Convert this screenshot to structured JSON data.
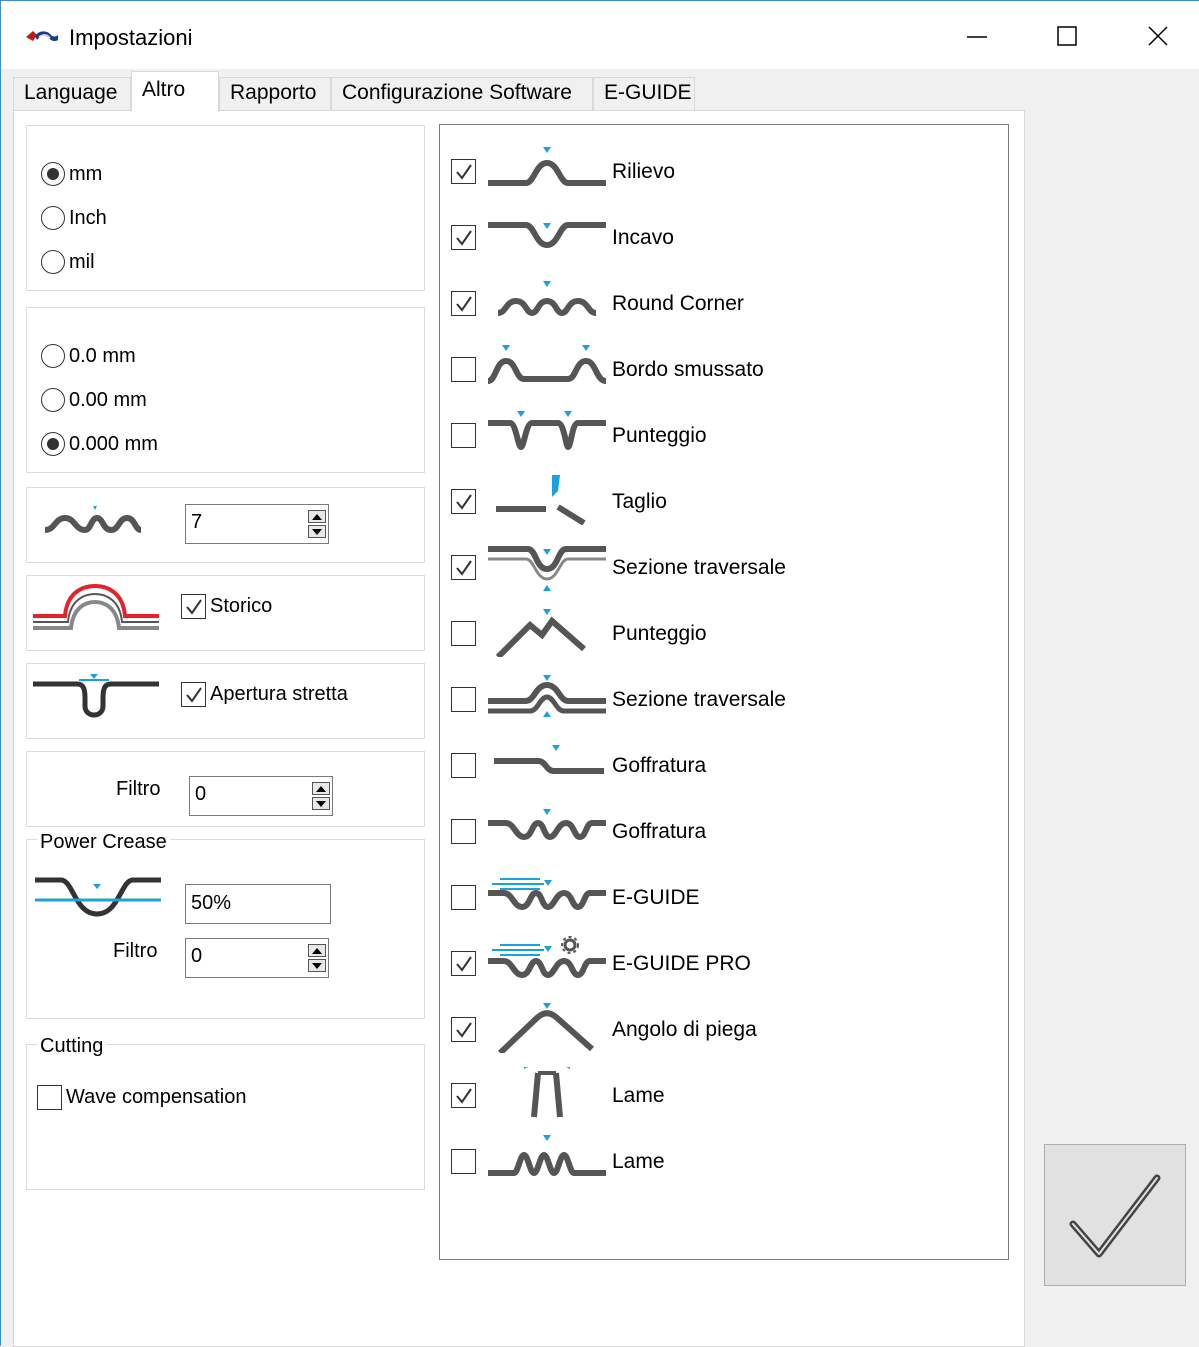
{
  "window": {
    "title": "Impostazioni",
    "controls": [
      "minimize-icon",
      "maximize-icon",
      "close-icon"
    ]
  },
  "tabs": [
    {
      "label": "Language",
      "active": false
    },
    {
      "label": "Altro",
      "active": true
    },
    {
      "label": "Rapporto",
      "active": false
    },
    {
      "label": "Configurazione Software",
      "active": false
    },
    {
      "label": "E-GUIDE",
      "active": false
    }
  ],
  "units": {
    "options": [
      "mm",
      "Inch",
      "mil"
    ],
    "selected": "mm"
  },
  "precision": {
    "options": [
      "0.0 mm",
      "0.00 mm",
      "0.000 mm"
    ],
    "selected": "0.000 mm"
  },
  "round_corner_setting": {
    "icon": "round-corner-wave-icon",
    "value": "7"
  },
  "storico": {
    "label": "Storico",
    "checked": true
  },
  "apertura_stretta": {
    "label": "Apertura stretta",
    "checked": true
  },
  "filter1": {
    "label": "Filtro",
    "value": "0"
  },
  "power_crease": {
    "title": "Power Crease",
    "percent": "50%",
    "filter_label": "Filtro",
    "filter_value": "0"
  },
  "cutting": {
    "title": "Cutting",
    "wave_compensation_label": "Wave compensation",
    "wave_compensation_checked": false
  },
  "tools": [
    {
      "label": "Rilievo",
      "checked": true,
      "icon": "bump-up-icon"
    },
    {
      "label": "Incavo",
      "checked": true,
      "icon": "bump-down-icon"
    },
    {
      "label": "Round Corner",
      "checked": true,
      "icon": "triple-wave-icon"
    },
    {
      "label": "Bordo smussato",
      "checked": false,
      "icon": "double-bump-icon"
    },
    {
      "label": "Punteggio",
      "checked": false,
      "icon": "double-v-icon"
    },
    {
      "label": "Taglio",
      "checked": true,
      "icon": "cut-blade-icon"
    },
    {
      "label": "Sezione traversale",
      "checked": true,
      "icon": "cross-section-down-icon"
    },
    {
      "label": "Punteggio",
      "checked": false,
      "icon": "peak-score-icon"
    },
    {
      "label": "Sezione traversale",
      "checked": false,
      "icon": "cross-section-up-icon"
    },
    {
      "label": "Goffratura",
      "checked": false,
      "icon": "step-emboss-icon"
    },
    {
      "label": "Goffratura",
      "checked": false,
      "icon": "wave-emboss-icon"
    },
    {
      "label": "E-GUIDE",
      "checked": false,
      "icon": "e-guide-icon"
    },
    {
      "label": "E-GUIDE PRO",
      "checked": true,
      "icon": "e-guide-pro-icon"
    },
    {
      "label": "Angolo di piega",
      "checked": true,
      "icon": "bend-angle-icon"
    },
    {
      "label": "Lame",
      "checked": true,
      "icon": "blade-pair-icon"
    },
    {
      "label": "Lame",
      "checked": false,
      "icon": "blade-wave-icon"
    }
  ],
  "colors": {
    "accent": "#1ba1e2",
    "stroke": "#555555",
    "red": "#e3242b"
  }
}
